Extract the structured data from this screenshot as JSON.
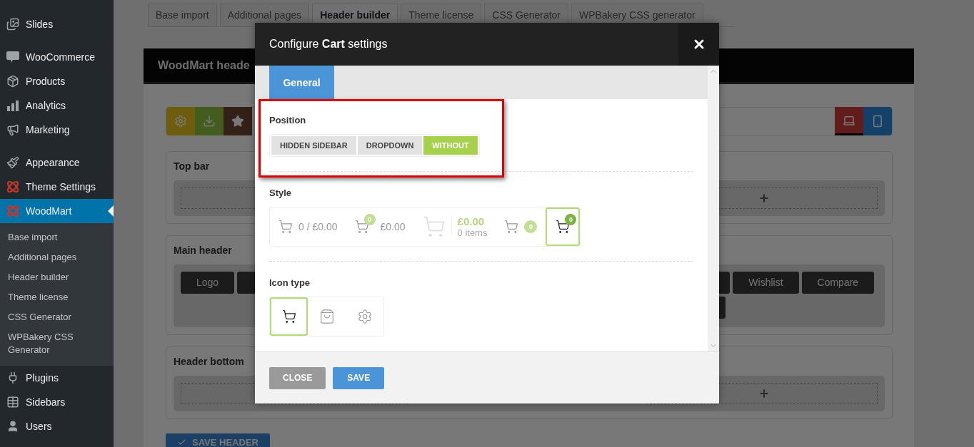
{
  "sidebar": {
    "groups": [
      {
        "items": [
          {
            "label": "Slides",
            "selected": false
          }
        ]
      },
      {
        "items": [
          {
            "label": "WooCommerce",
            "selected": false
          },
          {
            "label": "Products",
            "selected": false
          },
          {
            "label": "Analytics",
            "selected": false
          },
          {
            "label": "Marketing",
            "selected": false
          }
        ]
      },
      {
        "items": [
          {
            "label": "Appearance",
            "selected": false
          },
          {
            "label": "Theme Settings",
            "selected": false
          },
          {
            "label": "WoodMart",
            "selected": true,
            "children": [
              {
                "label": "Base import",
                "selected": false
              },
              {
                "label": "Additional pages",
                "selected": false
              },
              {
                "label": "Header builder",
                "selected": false
              },
              {
                "label": "Theme license",
                "selected": false
              },
              {
                "label": "CSS Generator",
                "selected": false
              },
              {
                "label": "WPBakery CSS Generator",
                "selected": false
              }
            ]
          },
          {
            "label": "Plugins",
            "selected": false
          },
          {
            "label": "Sidebars",
            "selected": false
          },
          {
            "label": "Users",
            "selected": false
          }
        ]
      }
    ]
  },
  "tabs": [
    {
      "label": "Base import",
      "selected": false
    },
    {
      "label": "Additional pages",
      "selected": false
    },
    {
      "label": "Header builder",
      "selected": true
    },
    {
      "label": "Theme license",
      "selected": false
    },
    {
      "label": "CSS Generator",
      "selected": false
    },
    {
      "label": "WPBakery CSS generator",
      "selected": false
    }
  ],
  "builder": {
    "title": "WoodMart heade",
    "rows": [
      {
        "title": "Top bar",
        "kind": "empty"
      },
      {
        "title": "Main header",
        "kind": "elements",
        "left_elements": [
          {
            "label": "Logo"
          }
        ],
        "right_elements": [
          {
            "label": "Wishlist"
          },
          {
            "label": "Compare"
          }
        ]
      },
      {
        "title": "Header bottom",
        "kind": "empty"
      }
    ],
    "save_button": "SAVE HEADER"
  },
  "modal": {
    "title": "Configure **Cart** settings",
    "tabs": [
      {
        "label": "General",
        "selected": true
      }
    ],
    "sections": [
      {
        "label": "Position",
        "kind": "buttons",
        "highlighted": true,
        "options": [
          {
            "label": "HIDDEN SIDEBAR",
            "selected": false
          },
          {
            "label": "DROPDOWN",
            "selected": false
          },
          {
            "label": "WITHOUT",
            "selected": true
          }
        ]
      },
      {
        "label": "Style",
        "kind": "styles",
        "options": [
          {
            "kind": "text",
            "text": "0 / £0.00",
            "selected": false
          },
          {
            "kind": "badge_text",
            "badge": "0",
            "text": "£0.00",
            "selected": false
          },
          {
            "kind": "totals",
            "amount": "£0.00",
            "count": "0 items",
            "selected": false
          },
          {
            "kind": "badge_side",
            "badge": "0",
            "selected": false
          },
          {
            "kind": "badge_top",
            "badge": "0",
            "selected": true
          }
        ]
      },
      {
        "label": "Icon type",
        "kind": "icons",
        "options": [
          {
            "selected": true
          },
          {
            "selected": false
          },
          {
            "selected": false
          }
        ]
      }
    ],
    "buttons": [
      {
        "label": "CLOSE",
        "kind": "secondary"
      },
      {
        "label": "SAVE",
        "kind": "primary"
      }
    ]
  }
}
